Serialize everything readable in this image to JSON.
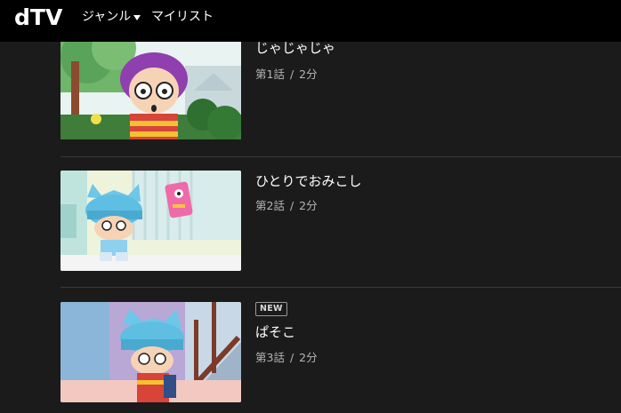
{
  "header": {
    "logo": "dTV",
    "nav": {
      "genre_label": "ジャンル",
      "mylist_label": "マイリスト"
    }
  },
  "episodes": [
    {
      "title": "じゃじゃじゃ",
      "episode": "第1話",
      "separator": "/",
      "duration": "2分",
      "badge": ""
    },
    {
      "title": "ひとりでおみこし",
      "episode": "第2話",
      "separator": "/",
      "duration": "2分",
      "badge": ""
    },
    {
      "title": "ぱそこ",
      "episode": "第3話",
      "separator": "/",
      "duration": "2分",
      "badge": "NEW"
    }
  ],
  "colors": {
    "background": "#1b1b1b",
    "header": "#000000",
    "text": "#ffffff",
    "meta_text": "#b5b5b5"
  }
}
